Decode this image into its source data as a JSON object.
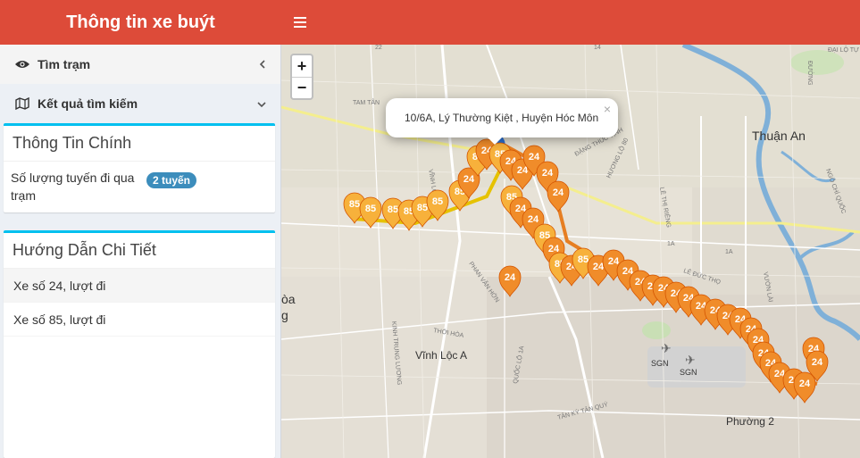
{
  "header": {
    "title": "Thông tin xe buýt",
    "menu_icon": "bars-icon"
  },
  "sidebar": {
    "find_station": {
      "label": "Tìm trạm",
      "icon": "eye-icon"
    },
    "search_results": {
      "label": "Kết quả tìm kiếm",
      "icon": "map-icon"
    },
    "main_info": {
      "title": "Thông Tin Chính",
      "routes_label": "Số lượng tuyến đi qua trạm",
      "routes_badge": "2 tuyến"
    },
    "details": {
      "title": "Hướng Dẫn Chi Tiết",
      "items": [
        {
          "label": "Xe số 24, lượt đi"
        },
        {
          "label": "Xe số 85, lượt đi"
        }
      ]
    }
  },
  "map": {
    "zoom_in": "+",
    "zoom_out": "−",
    "popup_text": "10/6A, Lý Thường Kiệt , Huyện Hóc Môn",
    "popup_close": "×",
    "places": [
      "Thuận An",
      "Vĩnh Lộc A",
      "Phường 2",
      "SGN",
      "SGN",
      "òa",
      "g"
    ],
    "road_labels": [
      "TAM TÂN",
      "PHAN VĂN HỚN",
      "ĐẶNG THÚC VỊNH",
      "HƯƠNG LỘ 80",
      "LÊ THỊ RIÊNG",
      "VĨNH LỘC",
      "KINH TRUNG LƯƠNG",
      "LÊ ĐỨC THỌ",
      "QUỐC LỘ 1A",
      "TÂN KỲ TÂN QUÝ",
      "ĐẠI LỘ TỰ DO",
      "VƯỜN LÀI",
      "NGÔ CHÍ QUỐC",
      "THỚI HÒA",
      "1A",
      "1A",
      "22",
      "14",
      "ĐƯỜNG"
    ],
    "route_numbers": [
      "85",
      "24"
    ],
    "marker_color": "#f08c2a",
    "marker_color_light": "#f7b13b"
  },
  "colors": {
    "header_bg": "#dd4b39",
    "box_border": "#00c0ef",
    "badge_bg": "#3c8dbc",
    "river": "#7fb0d8"
  }
}
